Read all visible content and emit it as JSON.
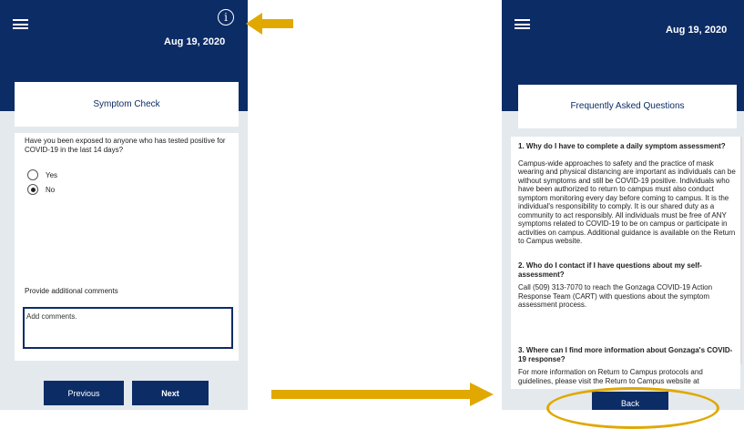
{
  "left_screen": {
    "date": "Aug 19, 2020",
    "card_title": "Symptom Check",
    "question": "Have you been exposed to anyone who has tested positive for COVID-19 in the last 14 days?",
    "options": [
      {
        "label": "Yes",
        "selected": false
      },
      {
        "label": "No",
        "selected": true
      }
    ],
    "comments_label": "Provide additional comments",
    "comments_value": "Add comments.",
    "previous_label": "Previous",
    "next_label": "Next"
  },
  "right_screen": {
    "date": "Aug 19, 2020",
    "card_title": "Frequently Asked Questions",
    "faqs": [
      {
        "question": "1. Why do I have to complete a daily symptom assessment?",
        "answer": "Campus-wide approaches to safety and the practice of mask wearing and physical distancing are important as individuals can be without symptoms and still be COVID-19 positive. Individuals who have been authorized to return to campus must also conduct symptom monitoring every day before coming to campus. It is the individual's responsibility to comply. It is our shared duty as a community to act responsibly. All individuals must be free of ANY symptoms related to COVID-19 to be on campus or participate in activities on campus. Additional guidance is available on the Return to Campus website."
      },
      {
        "question": "2. Who do I contact if I have questions about my self-assessment?",
        "answer": "Call (509) 313-7070 to reach the Gonzaga COVID-19 Action Response Team (CART) with questions about the symptom assessment process."
      },
      {
        "question": "3. Where can I find more information about Gonzaga's COVID-19 response?",
        "answer": "For more information on Return to Campus protocols and guidelines, please visit the Return to Campus website at"
      }
    ],
    "back_label": "Back"
  },
  "colors": {
    "header": "#0c2c66",
    "panel_bg": "#e4e9ed",
    "annotation": "#e0a800"
  }
}
